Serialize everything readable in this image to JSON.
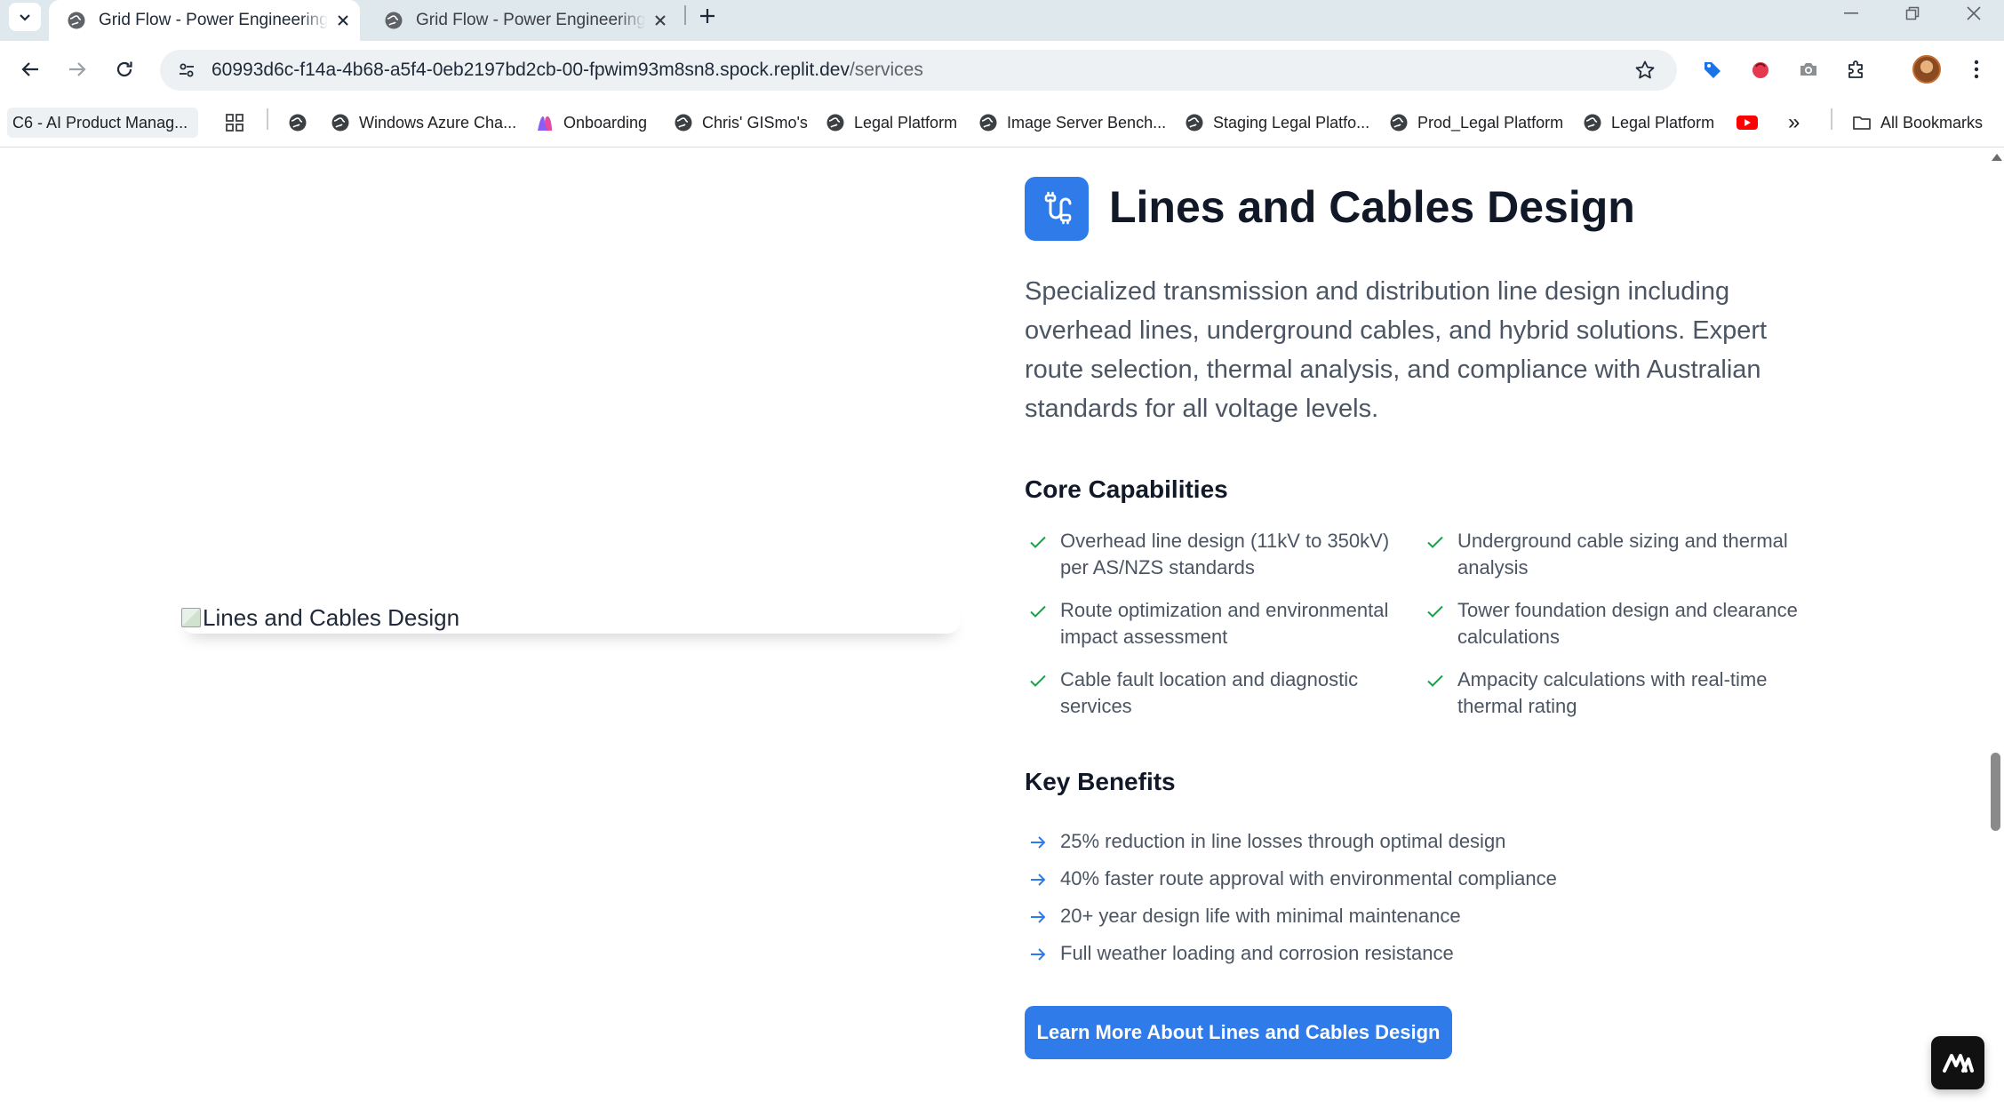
{
  "browser": {
    "tabs": [
      {
        "title": "Grid Flow - Power Engineering Services",
        "active": true
      },
      {
        "title": "Grid Flow - Power Engineering Services",
        "active": false
      }
    ],
    "url_host": "60993d6c-f14a-4b68-a5f4-0eb2197bd2cb-00-fpwim93m8sn8.spock.replit.dev",
    "url_path": "/services",
    "bookmarks": [
      "C6 - AI Product Manag...",
      "Windows Azure Cha...",
      "Onboarding",
      "Chris' GISmo's",
      "Legal Platform",
      "Image Server Bench...",
      "Staging Legal Platfo...",
      "Prod_Legal Platform",
      "Legal Platform"
    ],
    "all_bookmarks_label": "All Bookmarks",
    "overflow_label": "»"
  },
  "service": {
    "image_alt": "Lines and Cables Design",
    "icon": "cable-icon",
    "title": "Lines and Cables Design",
    "description": "Specialized transmission and distribution line design including overhead lines, underground cables, and hybrid solutions. Expert route selection, thermal analysis, and compliance with Australian standards for all voltage levels.",
    "capabilities_heading": "Core Capabilities",
    "capabilities": [
      "Overhead line design (11kV to 350kV) per AS/NZS standards",
      "Underground cable sizing and thermal analysis",
      "Route optimization and environmental impact assessment",
      "Tower foundation design and clearance calculations",
      "Cable fault location and diagnostic services",
      "Ampacity calculations with real-time thermal rating"
    ],
    "benefits_heading": "Key Benefits",
    "benefits": [
      "25% reduction in line losses through optimal design",
      "40% faster route approval with environmental compliance",
      "20+ year design life with minimal maintenance",
      "Full weather loading and corrosion resistance"
    ],
    "cta_label": "Learn More About Lines and Cables Design"
  },
  "colors": {
    "accent": "#2f7bea",
    "check": "#16a34a",
    "heading": "#111827",
    "body_text": "#4b5563"
  }
}
